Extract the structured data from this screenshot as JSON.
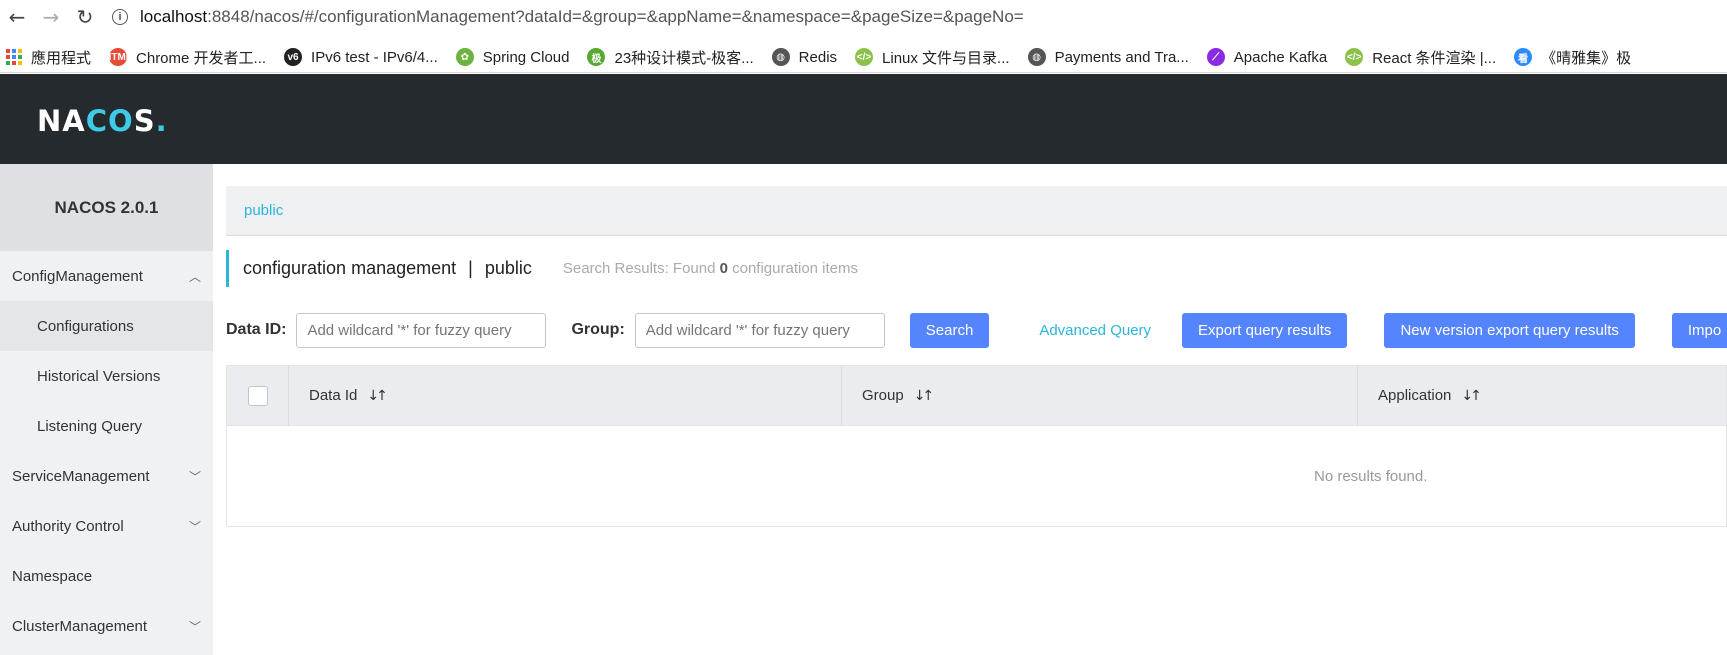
{
  "browser": {
    "url_host": "localhost",
    "url_rest": ":8848/nacos/#/configurationManagement?dataId=&group=&appName=&namespace=&pageSize=&pageNo=",
    "bookmarks": [
      {
        "label": "應用程式",
        "icon": "apps-grid-icon"
      },
      {
        "label": "Chrome 开发者工...",
        "icon": "html-icon",
        "color": "#e44d3a",
        "glyph": "HTML"
      },
      {
        "label": "IPv6 test - IPv6/4...",
        "icon": "v6-icon",
        "color": "#222222",
        "glyph": "v6"
      },
      {
        "label": "Spring Cloud",
        "icon": "spring-icon",
        "color": "#6db33f",
        "glyph": "✿"
      },
      {
        "label": "23种设计模式-极客...",
        "icon": "geek-icon",
        "color": "#5aa832",
        "glyph": "极"
      },
      {
        "label": "Redis",
        "icon": "globe-icon",
        "color": "#555555",
        "glyph": "◍"
      },
      {
        "label": "Linux 文件与目录...",
        "icon": "code-icon",
        "color": "#8bc34a",
        "glyph": "</>"
      },
      {
        "label": "Payments and Tra...",
        "icon": "globe-icon",
        "color": "#555555",
        "glyph": "◍"
      },
      {
        "label": "Apache Kafka",
        "icon": "feather-icon",
        "color": "#8a2be2",
        "glyph": "⟋"
      },
      {
        "label": "React 条件渲染 |...",
        "icon": "code-icon",
        "color": "#8bc34a",
        "glyph": "</>"
      },
      {
        "label": "《晴雅集》极",
        "icon": "video-icon",
        "color": "#2e8bff",
        "glyph": "看"
      }
    ]
  },
  "header": {
    "logo_n": "N",
    "logo_a": "A",
    "logo_c": "C",
    "logo_o": "O",
    "logo_s": "S",
    "logo_dot": "."
  },
  "sidebar": {
    "version": "NACOS 2.0.1",
    "config_management": "ConfigManagement",
    "configurations": "Configurations",
    "historical_versions": "Historical Versions",
    "listening_query": "Listening Query",
    "service_management": "ServiceManagement",
    "authority_control": "Authority Control",
    "namespace": "Namespace",
    "cluster_management": "ClusterManagement"
  },
  "main": {
    "namespace_tab": "public",
    "title": "configuration management",
    "title_sep": "|",
    "title_ns": "public",
    "results_prefix": "Search Results: Found",
    "results_count": "0",
    "results_suffix": "configuration items",
    "dataid_label": "Data ID:",
    "dataid_placeholder": "Add wildcard '*' for fuzzy query",
    "group_label": "Group:",
    "group_placeholder": "Add wildcard '*' for fuzzy query",
    "search_btn": "Search",
    "advanced_query": "Advanced Query",
    "export_btn": "Export query results",
    "new_export_btn": "New version export query results",
    "import_btn": "Impo",
    "table": {
      "columns": [
        "Data Id",
        "Group",
        "Application"
      ],
      "sort_glyph": "↓↑",
      "empty": "No results found."
    }
  }
}
